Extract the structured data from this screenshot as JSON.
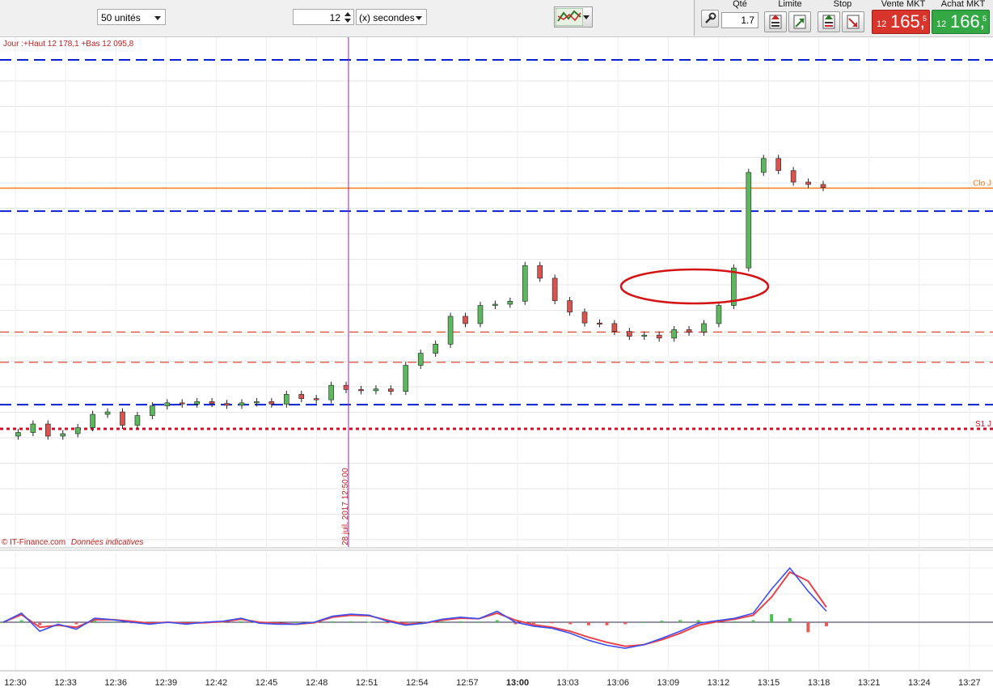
{
  "toolbar": {
    "units_select": "50 unités",
    "interval_value": "12",
    "interval_unit": "(x) secondes",
    "qty_label": "Qté",
    "qty_value": "1.7",
    "limit_label": "Limite",
    "stop_label": "Stop",
    "sell_label": "Vente MKT",
    "buy_label": "Achat MKT",
    "sell_prefix": "12",
    "sell_price": "165,",
    "sell_decimal": "5",
    "buy_prefix": "12",
    "buy_price": "166,",
    "buy_decimal": "5"
  },
  "colors": {
    "up_candle": "#5cb85c",
    "down_candle": "#d9534f",
    "pivot_blue": "#0a1fd0",
    "pivot_red": "#e0483c",
    "support": "#d0102a",
    "close_line": "#f07a1c",
    "macd_blue": "#3d4ff0",
    "macd_red": "#e8424a"
  },
  "chart_data": {
    "type": "candlestick",
    "info_text": "Jour :+Haut 12 178,1 +Bas 12 095,8",
    "copyright": "© IT-Finance.com",
    "disclaimer": "Données indicatives",
    "cursor_date_label": "28 juil. 2017 12:50:00",
    "cursor_time": "12:50",
    "time_axis": [
      "12:30",
      "12:33",
      "12:36",
      "12:39",
      "12:42",
      "12:45",
      "12:48",
      "12:51",
      "12:54",
      "12:57",
      "13:00",
      "13:03",
      "13:06",
      "13:09",
      "13:12",
      "13:15",
      "13:18",
      "13:21",
      "13:24",
      "13:27"
    ],
    "time_axis_bold": "13:00",
    "levels": [
      {
        "name": "R1",
        "price": 12172,
        "style": "blue-dashed"
      },
      {
        "name": "Clo J",
        "price": 12150.8,
        "label": "Clo J",
        "style": "orange-solid"
      },
      {
        "name": "PP",
        "price": 12147,
        "style": "blue-dashed"
      },
      {
        "name": "r-upper",
        "price": 12127,
        "style": "red-dashed"
      },
      {
        "name": "r-lower",
        "price": 12122,
        "style": "red-dashed"
      },
      {
        "name": "PP2",
        "price": 12115,
        "style": "blue-dashed"
      },
      {
        "name": "S1 J",
        "price": 12111,
        "label": "S1 J",
        "style": "red-dotted"
      }
    ],
    "prices": [
      12109.8,
      12110.4,
      12111.8,
      12109.8,
      12110.2,
      12111.2,
      12113.4,
      12113.8,
      12111.6,
      12113.2,
      12114.8,
      12115.3,
      12115.1,
      12115.5,
      12115.2,
      12114.9,
      12115.3,
      12115.5,
      12115.1,
      12116.7,
      12116.0,
      12115.8,
      12118.2,
      12117.5,
      12117.3,
      12117.6,
      12117.2,
      12121.5,
      12123.5,
      12125.0,
      12129.6,
      12128.4,
      12131.4,
      12131.6,
      12132.1,
      12138.0,
      12135.9,
      12132.2,
      12130.3,
      12128.5,
      12128.4,
      12127.1,
      12126.3,
      12126.5,
      12126.0,
      12127.4,
      12127.0,
      12128.4,
      12131.4,
      12137.6,
      12153.4,
      12155.7,
      12153.7,
      12151.8,
      12151.4,
      12150.9
    ],
    "macd": {
      "line": [
        0.0,
        0.18,
        -0.18,
        -0.04,
        -0.14,
        0.08,
        0.05,
        0.0,
        -0.04,
        0.0,
        -0.04,
        0.0,
        0.02,
        0.08,
        -0.02,
        -0.04,
        -0.04,
        0.0,
        0.12,
        0.16,
        0.14,
        0.02,
        -0.06,
        -0.02,
        0.06,
        0.1,
        0.07,
        0.22,
        0.0,
        -0.08,
        -0.12,
        -0.22,
        -0.36,
        -0.46,
        -0.52,
        -0.45,
        -0.32,
        -0.18,
        -0.02,
        0.03,
        0.08,
        0.18,
        0.66,
        1.08,
        0.62,
        0.22
      ],
      "signal": [
        0.0,
        0.15,
        -0.1,
        -0.06,
        -0.1,
        0.05,
        0.05,
        0.02,
        -0.02,
        0.0,
        -0.02,
        -0.01,
        0.01,
        0.06,
        0.0,
        -0.02,
        -0.04,
        -0.01,
        0.1,
        0.14,
        0.13,
        0.04,
        -0.04,
        -0.02,
        0.04,
        0.08,
        0.07,
        0.18,
        0.04,
        -0.05,
        -0.1,
        -0.18,
        -0.3,
        -0.4,
        -0.48,
        -0.45,
        -0.35,
        -0.22,
        -0.06,
        0.01,
        0.06,
        0.14,
        0.5,
        1.0,
        0.82,
        0.3
      ],
      "histogram": [
        0.0,
        0.04,
        -0.06,
        0.02,
        -0.04,
        0.03,
        0.0,
        -0.02,
        -0.02,
        0.0,
        -0.02,
        0.01,
        0.01,
        0.02,
        -0.02,
        -0.02,
        0.0,
        0.01,
        0.02,
        0.02,
        0.01,
        -0.02,
        -0.02,
        0.0,
        0.02,
        0.02,
        0.0,
        0.04,
        -0.04,
        -0.03,
        -0.02,
        -0.04,
        -0.06,
        -0.06,
        -0.04,
        0.0,
        0.03,
        0.04,
        0.04,
        0.02,
        0.02,
        0.04,
        0.16,
        0.08,
        -0.2,
        -0.08
      ]
    }
  }
}
